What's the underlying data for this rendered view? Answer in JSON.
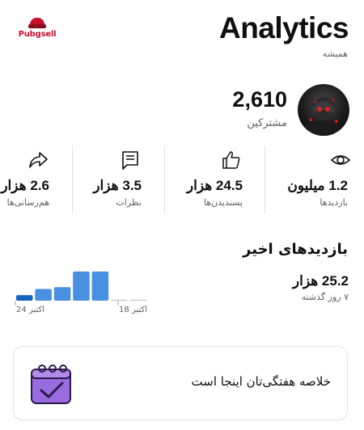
{
  "header": {
    "logo_text": "Pubgsell",
    "title": "Analytics",
    "period": "همیشه"
  },
  "channel": {
    "subscriber_count": "2,610",
    "subscriber_label": "مشترکین"
  },
  "stats": [
    {
      "icon": "eye-icon",
      "value": "1.2 میلیون",
      "label": "بازدیدها"
    },
    {
      "icon": "thumbs-up-icon",
      "value": "24.5 هزار",
      "label": "پسندیدن‌ها"
    },
    {
      "icon": "comment-icon",
      "value": "3.5 هزار",
      "label": "نظرات"
    },
    {
      "icon": "share-icon",
      "value": "2.6 هزار",
      "label": "هم‌رسانی‌ها"
    }
  ],
  "recent": {
    "title": "بازدیدهای اخیر",
    "value": "25.2 هزار",
    "period": "۷ روز گذشته"
  },
  "chart_data": {
    "type": "bar",
    "categories": [
      "1",
      "2",
      "3",
      "4",
      "5",
      "6",
      "7"
    ],
    "values": [
      0.18,
      0.38,
      0.44,
      0.95,
      0.95,
      0,
      0
    ],
    "tick_labels": [
      "24 اکتبر",
      "اکتبر 18"
    ],
    "colors": {
      "highlight": "#1565c0",
      "bar": "#4a90e2",
      "empty": "#c7c7c7"
    }
  },
  "summary_card": {
    "text": "خلاصه هفتگی‌تان اینجا است",
    "icon": "calendar-check-icon"
  }
}
